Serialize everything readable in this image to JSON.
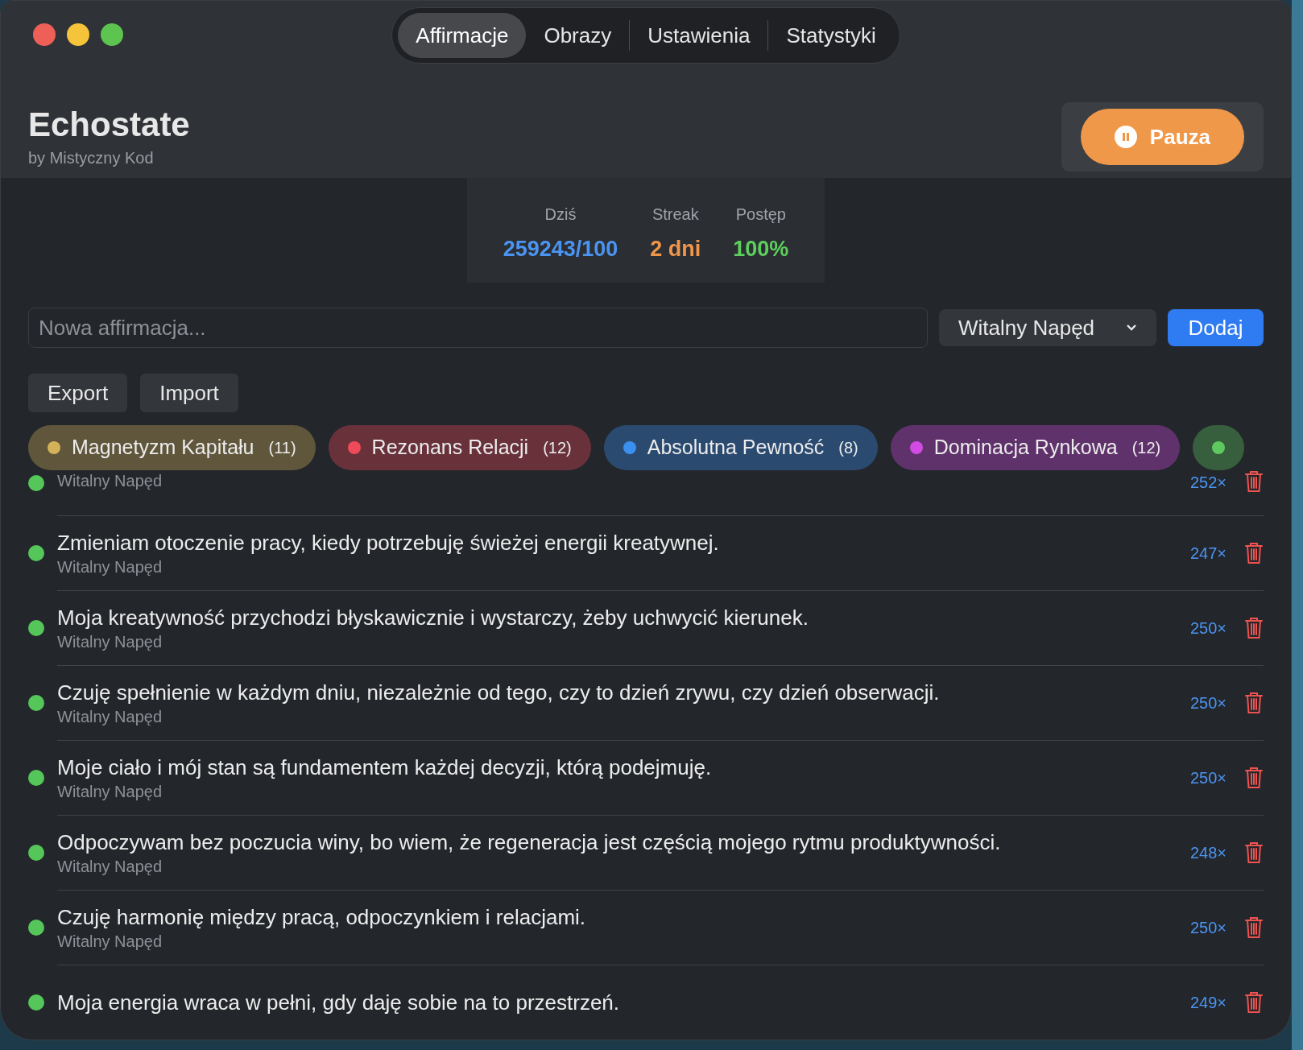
{
  "tabs": [
    {
      "label": "Affirmacje",
      "selected": true
    },
    {
      "label": "Obrazy",
      "selected": false
    },
    {
      "label": "Ustawienia",
      "selected": false
    },
    {
      "label": "Statystyki",
      "selected": false
    }
  ],
  "app": {
    "title": "Echostate",
    "subtitle": "by Mistyczny Kod"
  },
  "pause_button": {
    "label": "Pauza"
  },
  "stats": [
    {
      "label": "Dziś",
      "value": "259243/100",
      "color": "#4b95f2"
    },
    {
      "label": "Streak",
      "value": "2 dni",
      "color": "#f0954a"
    },
    {
      "label": "Postęp",
      "value": "100%",
      "color": "#5ccf5c"
    }
  ],
  "new_affirmation": {
    "placeholder": "Nowa affirmacja..."
  },
  "category_select": {
    "value": "Witalny Napęd"
  },
  "add_button": {
    "label": "Dodaj"
  },
  "actions": [
    "Export",
    "Import"
  ],
  "categories": [
    {
      "name": "Magnetyzm Kapitału",
      "count": "(11)",
      "color": "#d4b25a"
    },
    {
      "name": "Rezonans Relacji",
      "count": "(12)",
      "color": "#ee4a5a"
    },
    {
      "name": "Absolutna Pewność",
      "count": "(8)",
      "color": "#3b8ff0"
    },
    {
      "name": "Dominacja Rynkowa",
      "count": "(12)",
      "color": "#d24be2"
    },
    {
      "color": "#5fc95f"
    }
  ],
  "affirmations": [
    {
      "category": "Witalny Napęd",
      "count": "252×"
    },
    {
      "text": "Zmieniam otoczenie pracy, kiedy potrzebuję świeżej energii kreatywnej.",
      "category": "Witalny Napęd",
      "count": "247×"
    },
    {
      "text": "Moja kreatywność przychodzi błyskawicznie i wystarczy, żeby uchwycić kierunek.",
      "category": "Witalny Napęd",
      "count": "250×"
    },
    {
      "text": "Czuję spełnienie w każdym dniu, niezależnie od tego, czy to dzień zrywu, czy dzień obserwacji.",
      "category": "Witalny Napęd",
      "count": "250×"
    },
    {
      "text": "Moje ciało i mój stan są fundamentem każdej decyzji, którą podejmuję.",
      "category": "Witalny Napęd",
      "count": "250×"
    },
    {
      "text": "Odpoczywam bez poczucia winy, bo wiem, że regeneracja jest częścią mojego rytmu produktywności.",
      "category": "Witalny Napęd",
      "count": "248×"
    },
    {
      "text": "Czuję harmonię między pracą, odpoczynkiem i relacjami.",
      "category": "Witalny Napęd",
      "count": "250×"
    },
    {
      "text": "Moja energia wraca w pełni, gdy daję sobie na to przestrzeń.",
      "count": "249×"
    }
  ]
}
